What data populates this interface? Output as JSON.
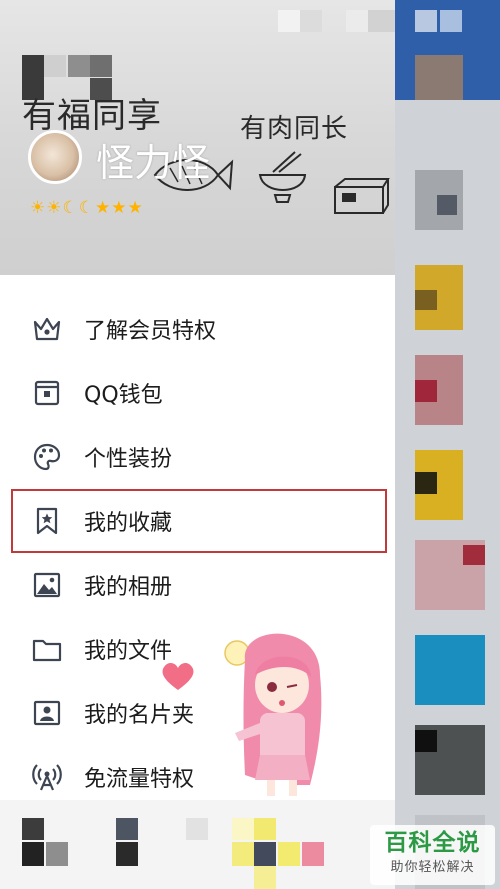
{
  "profile": {
    "nickname": "怪力怪",
    "level_icons": "☀☀☾☾★★★"
  },
  "header": {
    "scribble_left": "有福同享",
    "scribble_right": "有肉同长"
  },
  "menu": {
    "items": [
      {
        "label": "了解会员特权",
        "icon": "crown-icon"
      },
      {
        "label": "QQ钱包",
        "icon": "wallet-icon"
      },
      {
        "label": "个性装扮",
        "icon": "palette-icon"
      },
      {
        "label": "我的收藏",
        "icon": "bookmark-star-icon",
        "highlighted": true
      },
      {
        "label": "我的相册",
        "icon": "picture-icon"
      },
      {
        "label": "我的文件",
        "icon": "folder-icon"
      },
      {
        "label": "我的名片夹",
        "icon": "contact-card-icon"
      },
      {
        "label": "免流量特权",
        "icon": "signal-tower-icon"
      }
    ]
  },
  "watermark": {
    "main": "百科全说",
    "sub": "助你轻松解决"
  },
  "colors": {
    "highlight_border": "#c0393b",
    "icon_stroke": "#3d4552",
    "watermark_green": "#2c9a45"
  }
}
